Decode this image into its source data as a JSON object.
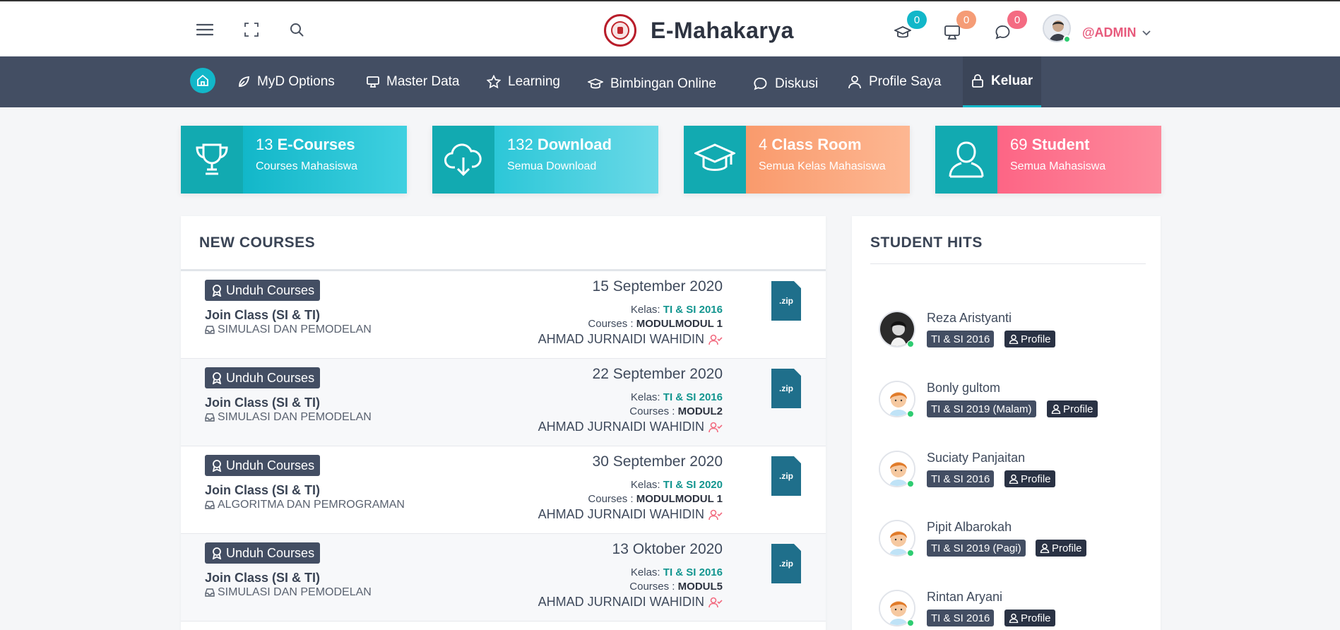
{
  "header": {
    "brand": "E-Mahakarya",
    "notifications": [
      {
        "icon": "graduation-cap-icon",
        "count": "0",
        "color": "#12b7c9"
      },
      {
        "icon": "monitor-icon",
        "count": "0",
        "color": "#f59c76"
      },
      {
        "icon": "chat-icon",
        "count": "0",
        "color": "#f46b82"
      }
    ],
    "user": "@ADMIN"
  },
  "nav": {
    "items": [
      {
        "label": "MyD Options",
        "icon": "leaf-icon"
      },
      {
        "label": "Master Data",
        "icon": "monitor-icon"
      },
      {
        "label": "Learning",
        "icon": "star-icon"
      },
      {
        "label": "Bimbingan Online",
        "icon": "graduation-cap-icon"
      },
      {
        "label": "Diskusi",
        "icon": "chat-icon"
      },
      {
        "label": "Profile Saya",
        "icon": "user-icon"
      },
      {
        "label": "Keluar",
        "icon": "lock-icon"
      }
    ]
  },
  "stats": [
    {
      "count": "13",
      "label": "E-Courses",
      "sub": "Courses Mahasiswa",
      "icon": "trophy-icon",
      "colors": [
        "#12b7c9",
        "#3fd0e0"
      ]
    },
    {
      "count": "132",
      "label": "Download",
      "sub": "Semua Download",
      "icon": "cloud-download-icon",
      "colors": [
        "#2cc7d8",
        "#6ad9e7"
      ]
    },
    {
      "count": "4",
      "label": "Class Room",
      "sub": "Semua Kelas Mahasiswa",
      "icon": "graduation-cap-icon",
      "colors": [
        "#f99a6c",
        "#fdb792"
      ]
    },
    {
      "count": "69",
      "label": "Student",
      "sub": "Semua Mahasiswa",
      "icon": "user-icon",
      "colors": [
        "#fd6585",
        "#fd8a9c"
      ]
    }
  ],
  "courses_panel": {
    "title": "NEW COURSES",
    "download_label": "Unduh Courses",
    "kelas_label": "Kelas:",
    "courses_label": "Courses :",
    "file_label": ".zip",
    "items": [
      {
        "title": "Join Class (SI & TI)",
        "subject": "SIMULASI DAN PEMODELAN",
        "date": "15 September 2020",
        "kelas": "TI & SI 2016",
        "modul": "MODULMODUL 1",
        "author": "AHMAD JURNAIDI WAHIDIN"
      },
      {
        "title": "Join Class (SI & TI)",
        "subject": "SIMULASI DAN PEMODELAN",
        "date": "22 September 2020",
        "kelas": "TI & SI 2016",
        "modul": "MODUL2",
        "author": "AHMAD JURNAIDI WAHIDIN"
      },
      {
        "title": "Join Class (SI & TI)",
        "subject": "ALGORITMA DAN PEMROGRAMAN",
        "date": "30 September 2020",
        "kelas": "TI & SI 2020",
        "modul": "MODULMODUL 1",
        "author": "AHMAD JURNAIDI WAHIDIN"
      },
      {
        "title": "Join Class (SI & TI)",
        "subject": "SIMULASI DAN PEMODELAN",
        "date": "13 Oktober 2020",
        "kelas": "TI & SI 2016",
        "modul": "MODUL5",
        "author": "AHMAD JURNAIDI WAHIDIN"
      }
    ]
  },
  "hits_panel": {
    "title": "STUDENT HITS",
    "profile_label": "Profile",
    "items": [
      {
        "name": "Reza Aristyanti",
        "kelas": "TI & SI 2016"
      },
      {
        "name": "Bonly gultom",
        "kelas": "TI & SI 2019 (Malam)"
      },
      {
        "name": "Suciaty Panjaitan",
        "kelas": "TI & SI 2016"
      },
      {
        "name": "Pipit Albarokah",
        "kelas": "TI & SI 2019 (Pagi)"
      },
      {
        "name": "Rintan Aryani",
        "kelas": "TI & SI 2016"
      }
    ]
  }
}
